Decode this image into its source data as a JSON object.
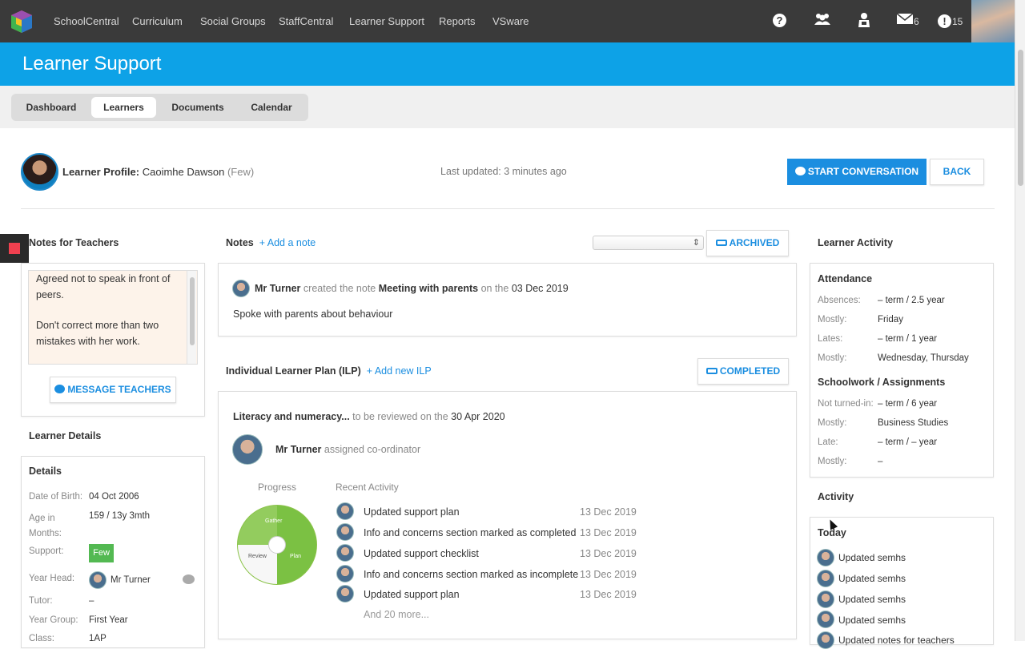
{
  "topnav": {
    "items": [
      "SchoolCentral",
      "Curriculum",
      "Social Groups",
      "StaffCentral",
      "Learner Support",
      "Reports",
      "VSware"
    ],
    "icons": [
      {
        "name": "help-icon",
        "glyph": "?"
      },
      {
        "name": "groups-icon",
        "glyph": "👥"
      },
      {
        "name": "person-icon",
        "glyph": "♙"
      },
      {
        "name": "mail-icon",
        "glyph": "✉",
        "count": "6"
      },
      {
        "name": "alert-icon",
        "glyph": "!",
        "count": "15"
      }
    ]
  },
  "banner": {
    "title": "Learner Support"
  },
  "subnav": {
    "tabs": [
      "Dashboard",
      "Learners",
      "Documents",
      "Calendar"
    ],
    "active": "Learners"
  },
  "profile": {
    "label": "Learner Profile:",
    "name": "Caoimhe Dawson",
    "support_level": "(Few)",
    "last_updated": "Last updated: 3 minutes ago",
    "start_conversation": "START CONVERSATION",
    "back": "BACK"
  },
  "notes_for_teachers": {
    "title": "Notes for Teachers",
    "text1": "Agreed not to speak in front of peers.",
    "text2": "Don't correct more than two mistakes with her work.",
    "message_button": "MESSAGE TEACHERS"
  },
  "learner_details": {
    "title": "Learner Details",
    "panel_title": "Details",
    "dob_label": "Date of Birth:",
    "dob": "04 Oct 2006",
    "age_label": "Age in Months:",
    "age": "159 / 13y 3mth",
    "support_label": "Support:",
    "support": "Few",
    "yearhead_label": "Year Head:",
    "yearhead": "Mr Turner",
    "tutor_label": "Tutor:",
    "tutor": "–",
    "yeargroup_label": "Year Group:",
    "yeargroup": "First Year",
    "class_label": "Class:",
    "class": "1AP"
  },
  "notes": {
    "title": "Notes",
    "add": "+ Add a note",
    "archived": "ARCHIVED",
    "author": "Mr Turner",
    "verb": "created the note",
    "note_title": "Meeting with parents",
    "on": "on the",
    "date": "03 Dec 2019",
    "body": "Spoke with parents about behaviour"
  },
  "ilp": {
    "title": "Individual Learner Plan (ILP)",
    "add": "+ Add new ILP",
    "completed": "COMPLETED",
    "plan_name": "Literacy and numeracy...",
    "review_text": "to be reviewed on the",
    "review_date": "30 Apr 2020",
    "coordinator": "Mr Turner",
    "coordinator_text": "assigned co-ordinator",
    "progress_label": "Progress",
    "recent_label": "Recent Activity",
    "pie_labels": [
      "Gather",
      "Plan",
      "Review"
    ],
    "activities": [
      {
        "text": "Updated support plan",
        "date": "13 Dec 2019"
      },
      {
        "text": "Info and concerns section marked as completed",
        "date": "13 Dec 2019"
      },
      {
        "text": "Updated support checklist",
        "date": "13 Dec 2019"
      },
      {
        "text": "Info and concerns section marked as incomplete",
        "date": "13 Dec 2019"
      },
      {
        "text": "Updated support plan",
        "date": "13 Dec 2019"
      }
    ],
    "more": "And 20 more..."
  },
  "learner_activity": {
    "title": "Learner Activity",
    "attendance_title": "Attendance",
    "absences_label": "Absences:",
    "absences": "– term / 2.5 year",
    "mostly1_label": "Mostly:",
    "mostly1": "Friday",
    "lates_label": "Lates:",
    "lates": "– term / 1 year",
    "mostly2_label": "Mostly:",
    "mostly2": "Wednesday, Thursday",
    "schoolwork_title": "Schoolwork / Assignments",
    "notturned_label": "Not turned-in:",
    "notturned": "– term / 6 year",
    "mostly3_label": "Mostly:",
    "mostly3": "Business Studies",
    "late_label": "Late:",
    "late": "– term / – year",
    "mostly4_label": "Mostly:",
    "mostly4": "–",
    "activity_title": "Activity",
    "today_label": "Today",
    "feed": [
      "Updated semhs",
      "Updated semhs",
      "Updated semhs",
      "Updated semhs",
      "Updated notes for teachers"
    ]
  }
}
